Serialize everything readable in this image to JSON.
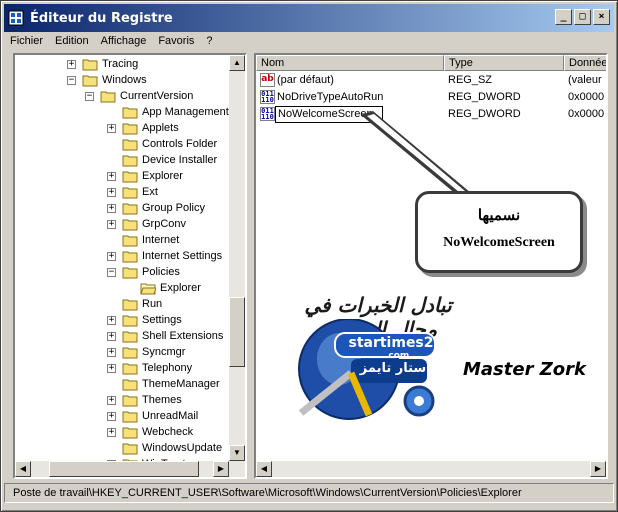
{
  "window": {
    "title": "Éditeur du Registre"
  },
  "titlebar": {
    "minimize": "_",
    "maximize": "□",
    "close": "×"
  },
  "menu": [
    "Fichier",
    "Edition",
    "Affichage",
    "Favoris",
    "?"
  ],
  "tree": [
    {
      "label": "Tracing",
      "level": 0,
      "expander": "+"
    },
    {
      "label": "Windows",
      "level": 0,
      "expander": "−"
    },
    {
      "label": "CurrentVersion",
      "level": 1,
      "expander": "−"
    },
    {
      "label": "App Management",
      "level": 2,
      "expander": ""
    },
    {
      "label": "Applets",
      "level": 2,
      "expander": "+"
    },
    {
      "label": "Controls Folder",
      "level": 2,
      "expander": ""
    },
    {
      "label": "Device Installer",
      "level": 2,
      "expander": ""
    },
    {
      "label": "Explorer",
      "level": 2,
      "expander": "+"
    },
    {
      "label": "Ext",
      "level": 2,
      "expander": "+"
    },
    {
      "label": "Group Policy",
      "level": 2,
      "expander": "+"
    },
    {
      "label": "GrpConv",
      "level": 2,
      "expander": "+"
    },
    {
      "label": "Internet",
      "level": 2,
      "expander": ""
    },
    {
      "label": "Internet Settings",
      "level": 2,
      "expander": "+"
    },
    {
      "label": "Policies",
      "level": 2,
      "expander": "−"
    },
    {
      "label": "Explorer",
      "level": 3,
      "expander": "",
      "open": true
    },
    {
      "label": "Run",
      "level": 2,
      "expander": ""
    },
    {
      "label": "Settings",
      "level": 2,
      "expander": "+"
    },
    {
      "label": "Shell Extensions",
      "level": 2,
      "expander": "+"
    },
    {
      "label": "Syncmgr",
      "level": 2,
      "expander": "+"
    },
    {
      "label": "Telephony",
      "level": 2,
      "expander": "+"
    },
    {
      "label": "ThemeManager",
      "level": 2,
      "expander": ""
    },
    {
      "label": "Themes",
      "level": 2,
      "expander": "+"
    },
    {
      "label": "UnreadMail",
      "level": 2,
      "expander": "+"
    },
    {
      "label": "Webcheck",
      "level": 2,
      "expander": "+"
    },
    {
      "label": "WindowsUpdate",
      "level": 2,
      "expander": ""
    },
    {
      "label": "WinTrust",
      "level": 2,
      "expander": "+"
    }
  ],
  "columns": {
    "name": "Nom",
    "type": "Type",
    "data": "Donnée"
  },
  "values": [
    {
      "name": "(par défaut)",
      "type": "REG_SZ",
      "data": "(valeur",
      "icon": "ab"
    },
    {
      "name": "NoDriveTypeAutoRun",
      "type": "REG_DWORD",
      "data": "0x0000",
      "icon": "bin"
    },
    {
      "name": "NoWelcomeScreen",
      "type": "REG_DWORD",
      "data": "0x0000",
      "icon": "bin",
      "editing": true
    }
  ],
  "callout": {
    "arabic": "نسميها",
    "english": "NoWelcomeScreen"
  },
  "watermark": {
    "arabic_top": "تبادل الخبرات في مجال الحاسب",
    "site": "startimes2",
    "site_tld": ".com",
    "arabic_logo": "ستار تايمز"
  },
  "signature": "Master Zork",
  "status": "Poste de travail\\HKEY_CURRENT_USER\\Software\\Microsoft\\Windows\\CurrentVersion\\Policies\\Explorer",
  "icons": {
    "app": "regedit-icon",
    "folder": "folder-icon",
    "open_folder": "folder-open-icon"
  }
}
